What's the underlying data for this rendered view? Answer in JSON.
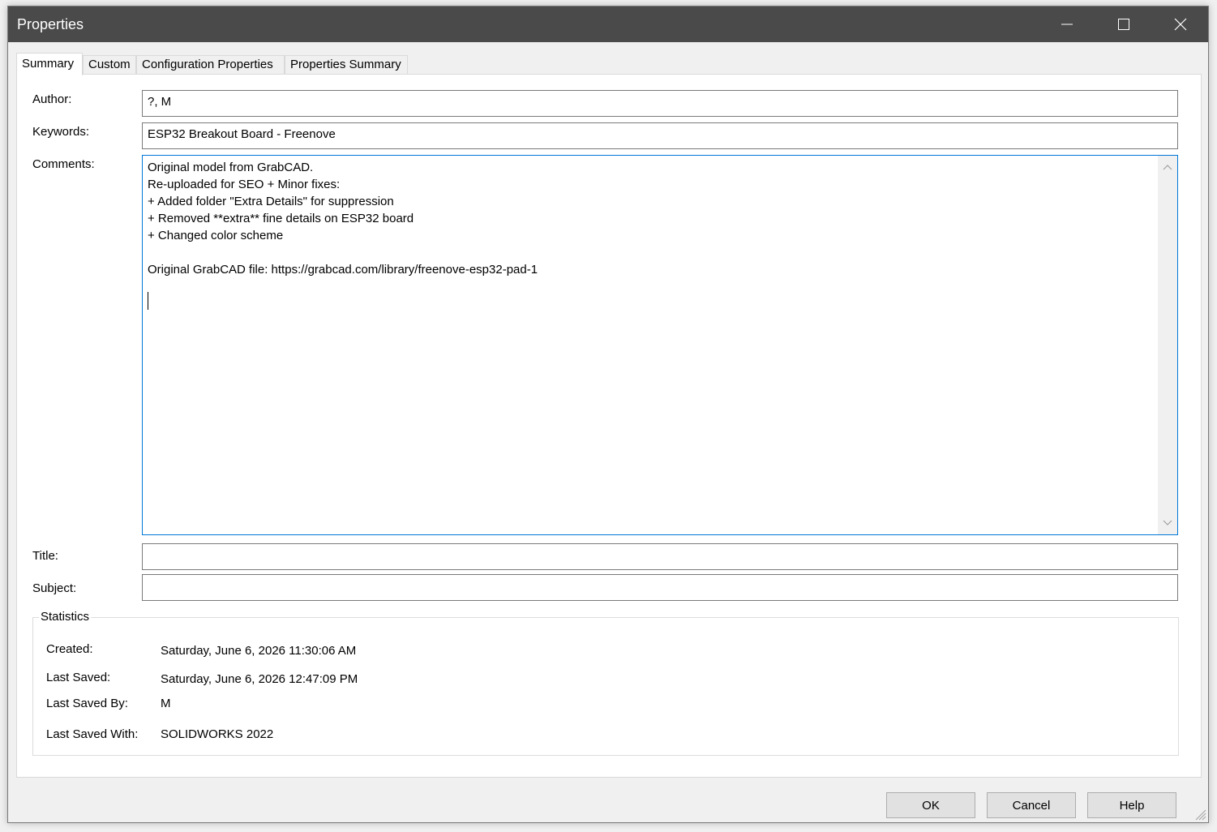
{
  "window": {
    "title": "Properties"
  },
  "tabs": [
    {
      "label": "Summary",
      "active": true
    },
    {
      "label": "Custom",
      "active": false
    },
    {
      "label": "Configuration Properties",
      "active": false
    },
    {
      "label": "Properties Summary",
      "active": false
    }
  ],
  "summary": {
    "author": {
      "label": "Author:",
      "value": "?, M"
    },
    "keywords": {
      "label": "Keywords:",
      "value": "ESP32 Breakout Board - Freenove"
    },
    "comments": {
      "label": "Comments:",
      "lines": [
        "Original model from GrabCAD.",
        "Re-uploaded for SEO + Minor fixes:",
        "+ Added folder \"Extra Details\" for suppression",
        "+ Removed **extra** fine details on ESP32 board",
        "+ Changed color scheme",
        "",
        "Original GrabCAD file: https://grabcad.com/library/freenove-esp32-pad-1"
      ]
    },
    "title": {
      "label": "Title:",
      "value": ""
    },
    "subject": {
      "label": "Subject:",
      "value": ""
    }
  },
  "statistics": {
    "legend": "Statistics",
    "created": {
      "label": "Created:",
      "value": "Saturday, June 6, 2026 11:30:06 AM"
    },
    "last_saved": {
      "label": "Last Saved:",
      "value": "Saturday, June 6, 2026 12:47:09 PM"
    },
    "last_saved_by": {
      "label": "Last Saved By:",
      "value": "M"
    },
    "last_saved_with": {
      "label": "Last Saved With:",
      "value": "SOLIDWORKS 2022"
    }
  },
  "buttons": {
    "ok": "OK",
    "cancel": "Cancel",
    "help": "Help"
  },
  "colors": {
    "titlebar": "#4a4a4a",
    "focus_border": "#0078d7",
    "button_face": "#e1e1e1"
  },
  "icons": [
    "minimize-icon",
    "maximize-icon",
    "close-icon",
    "scroll-up-icon",
    "scroll-down-icon",
    "resize-grip-icon"
  ]
}
